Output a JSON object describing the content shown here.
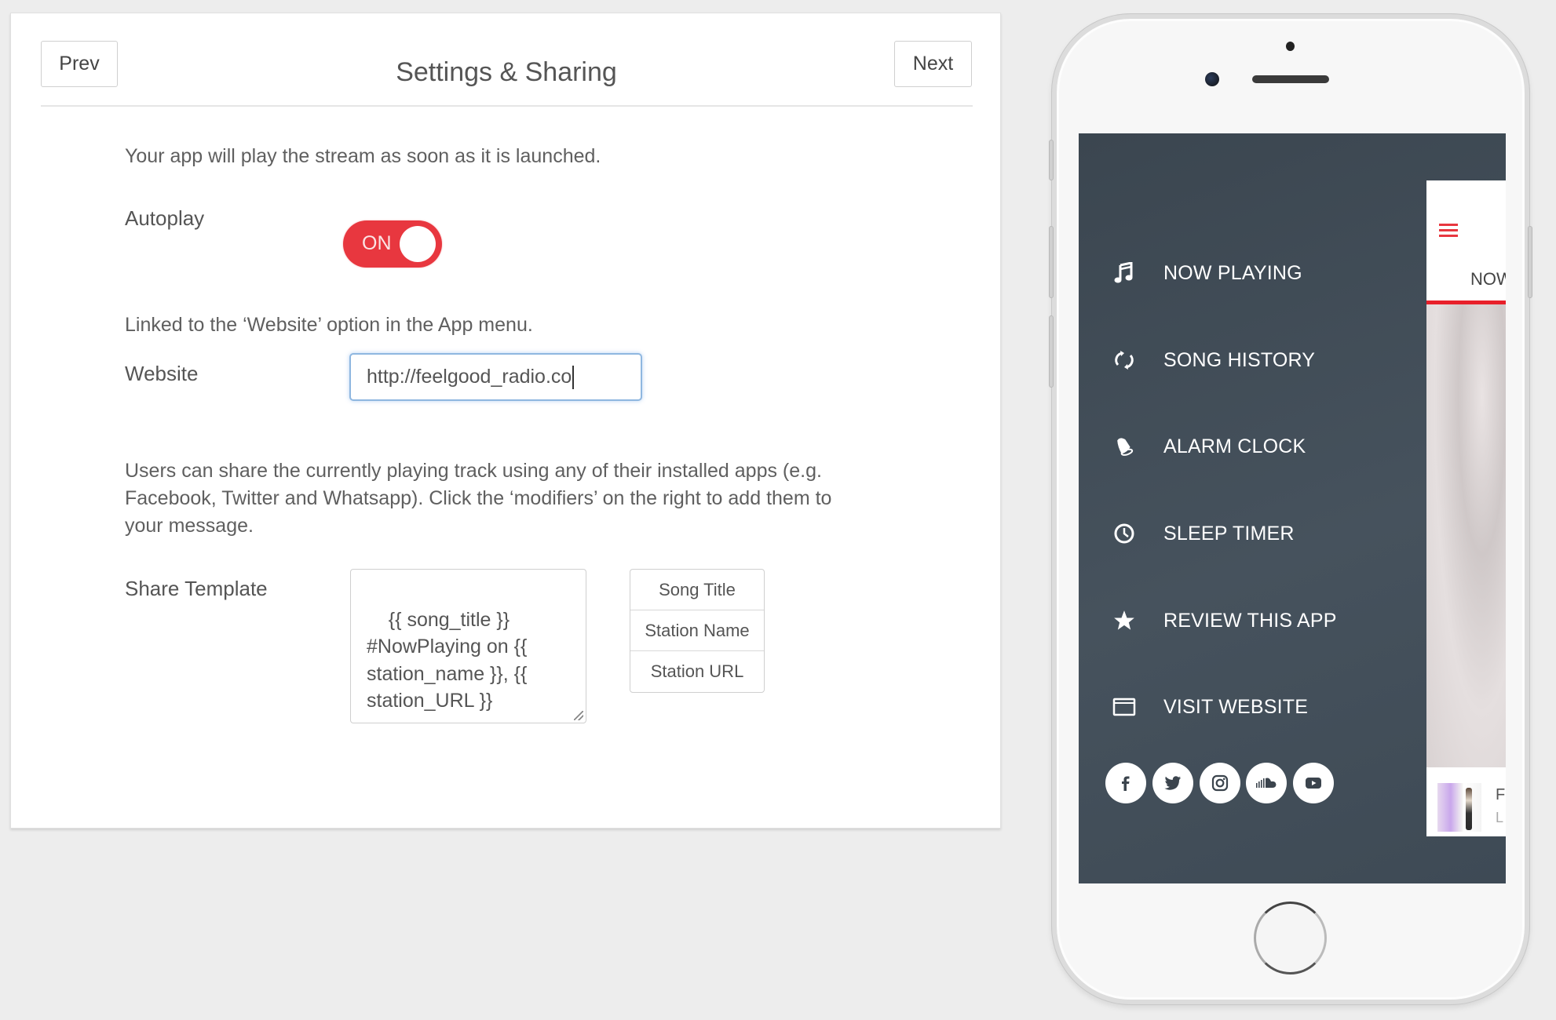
{
  "header": {
    "prev_label": "Prev",
    "title": "Settings & Sharing",
    "next_label": "Next"
  },
  "autoplay": {
    "description": "Your app will play the stream as soon as it is launched.",
    "label": "Autoplay",
    "toggle_text": "ON",
    "enabled": true
  },
  "website": {
    "description": "Linked to the ‘Website’ option in the App menu.",
    "label": "Website",
    "value": "http://feelgood_radio.co"
  },
  "sharing": {
    "description": "Users can share the currently playing track using any of their installed apps (e.g. Facebook, Twitter and Whatsapp). Click the ‘modifiers’ on the right to add them to your message.",
    "label": "Share Template",
    "template_value": "{{ song_title }}\n#NowPlaying on {{\nstation_name }}, {{\nstation_URL }}",
    "modifiers": [
      "Song Title",
      "Station Name",
      "Station URL"
    ]
  },
  "phone_preview": {
    "menu_items": [
      {
        "label": "NOW PLAYING",
        "icon": "music-note-icon"
      },
      {
        "label": "SONG HISTORY",
        "icon": "refresh-icon"
      },
      {
        "label": "ALARM CLOCK",
        "icon": "bell-icon"
      },
      {
        "label": "SLEEP TIMER",
        "icon": "clock-icon"
      },
      {
        "label": "REVIEW THIS APP",
        "icon": "star-icon"
      },
      {
        "label": "VISIT WEBSITE",
        "icon": "browser-window-icon"
      }
    ],
    "social_icons": [
      "facebook-icon",
      "twitter-icon",
      "instagram-icon",
      "soundcloud-icon",
      "youtube-icon"
    ],
    "app_peek": {
      "title_fragment": "NOW",
      "card_line1": "F",
      "card_line2": "L"
    },
    "accent_color": "#e8373f",
    "menu_bg_color": "#414d58"
  }
}
